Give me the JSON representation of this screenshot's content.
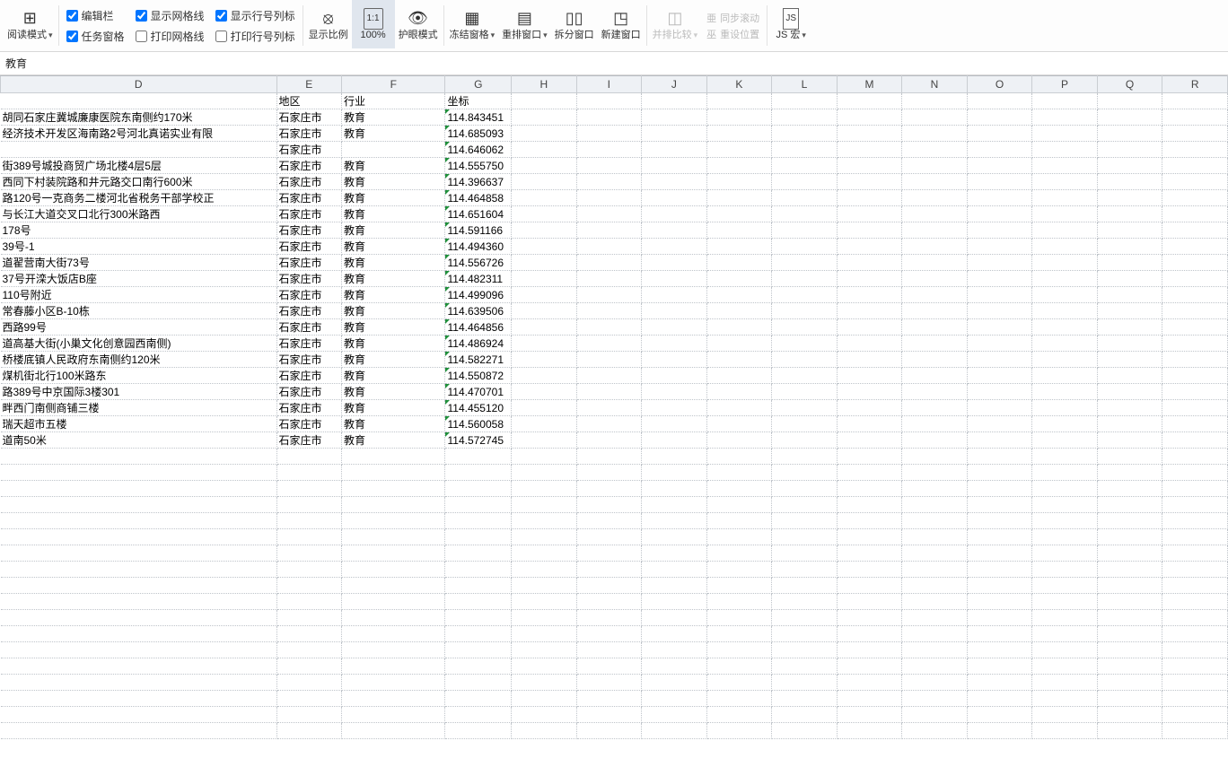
{
  "ribbon": {
    "readMode": "阅读模式",
    "chk_editBar": "编辑栏",
    "chk_taskPane": "任务窗格",
    "chk_showGrid": "显示网格线",
    "chk_printGrid": "打印网格线",
    "chk_showHeaders": "显示行号列标",
    "chk_printHeaders": "打印行号列标",
    "zoomRatio": "显示比例",
    "zoom100": "100%",
    "eyeProtect": "护眼模式",
    "freezePanes": "冻结窗格",
    "arrangeWin": "重排窗口",
    "splitWin": "拆分窗口",
    "newWin": "新建窗口",
    "sideBySide": "并排比较",
    "syncScroll": "同步滚动",
    "resetPos": "重设位置",
    "jsMacro": "JS 宏"
  },
  "fxbar": {
    "value": "教育"
  },
  "columns": [
    "D",
    "E",
    "F",
    "G",
    "H",
    "I",
    "J",
    "K",
    "L",
    "M",
    "N",
    "O",
    "P",
    "Q",
    "R"
  ],
  "headers": {
    "E": "地区",
    "F": "行业",
    "G": "坐标"
  },
  "rows": [
    {
      "D": "胡同石家庄冀城廉康医院东南侧约170米",
      "E": "石家庄市",
      "F": "教育",
      "G": "114.843451"
    },
    {
      "D": "经济技术开发区海南路2号河北真诺实业有限",
      "E": "石家庄市",
      "F": "教育",
      "G": "114.685093"
    },
    {
      "D": "",
      "E": "石家庄市",
      "F": "",
      "G": "114.646062"
    },
    {
      "D": "街389号城投商贸广场北楼4层5层",
      "E": "石家庄市",
      "F": "教育",
      "G": "114.555750"
    },
    {
      "D": "西同下村装院路和井元路交口南行600米",
      "E": "石家庄市",
      "F": "教育",
      "G": "114.396637"
    },
    {
      "D": "路120号一克商务二楼河北省税务干部学校正",
      "E": "石家庄市",
      "F": "教育",
      "G": "114.464858"
    },
    {
      "D": "与长江大道交叉口北行300米路西",
      "E": "石家庄市",
      "F": "教育",
      "G": "114.651604"
    },
    {
      "D": "178号",
      "E": "石家庄市",
      "F": "教育",
      "G": "114.591166"
    },
    {
      "D": "39号-1",
      "E": "石家庄市",
      "F": "教育",
      "G": "114.494360"
    },
    {
      "D": "道翟营南大街73号",
      "E": "石家庄市",
      "F": "教育",
      "G": "114.556726"
    },
    {
      "D": "37号开滦大饭店B座",
      "E": "石家庄市",
      "F": "教育",
      "G": "114.482311"
    },
    {
      "D": "110号附近",
      "E": "石家庄市",
      "F": "教育",
      "G": "114.499096"
    },
    {
      "D": "常春藤小区B-10栋",
      "E": "石家庄市",
      "F": "教育",
      "G": "114.639506"
    },
    {
      "D": "西路99号",
      "E": "石家庄市",
      "F": "教育",
      "G": "114.464856"
    },
    {
      "D": "道高基大街(小巢文化创意园西南侧)",
      "E": "石家庄市",
      "F": "教育",
      "G": "114.486924"
    },
    {
      "D": "桥楼底镇人民政府东南侧约120米",
      "E": "石家庄市",
      "F": "教育",
      "G": "114.582271"
    },
    {
      "D": "煤机街北行100米路东",
      "E": "石家庄市",
      "F": "教育",
      "G": "114.550872"
    },
    {
      "D": "路389号中京国际3楼301",
      "E": "石家庄市",
      "F": "教育",
      "G": "114.470701"
    },
    {
      "D": "畔西门南侧商铺三楼",
      "E": "石家庄市",
      "F": "教育",
      "G": "114.455120"
    },
    {
      "D": "瑞天超市五楼",
      "E": "石家庄市",
      "F": "教育",
      "G": "114.560058"
    },
    {
      "D": "道南50米",
      "E": "石家庄市",
      "F": "教育",
      "G": "114.572745"
    }
  ]
}
